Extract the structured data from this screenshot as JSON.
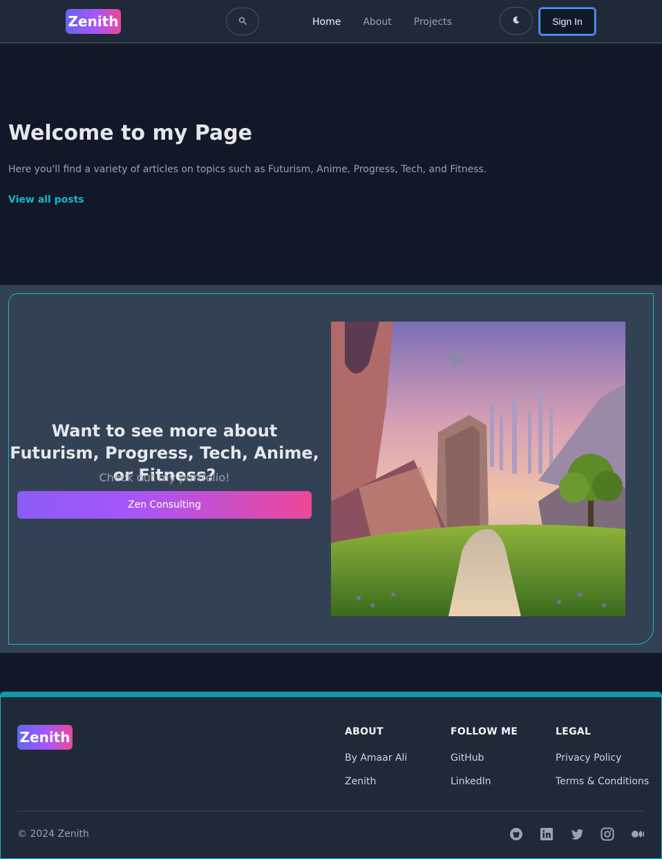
{
  "nav": {
    "logo": "Zenith",
    "links": [
      {
        "label": "Home",
        "active": true
      },
      {
        "label": "About",
        "active": false
      },
      {
        "label": "Projects",
        "active": false
      }
    ],
    "search_icon": "search-icon",
    "theme_icon": "moon-icon",
    "signin_label": "Sign In"
  },
  "hero": {
    "title": "Welcome to my Page",
    "subtitle": "Here you'll find a variety of articles on topics such as Futurism, Anime, Progress, Tech, and Fitness.",
    "link_label": "View all posts"
  },
  "promo": {
    "heading": "Want to see more about Futurism, Progress, Tech, Anime, or Fitness?",
    "subheading": "Check out my portfolio!",
    "button_label": "Zen Consulting",
    "image": "fantasy-landscape-image"
  },
  "footer": {
    "logo": "Zenith",
    "columns": [
      {
        "title": "ABOUT",
        "items": [
          "By Amaar Ali",
          "Zenith"
        ]
      },
      {
        "title": "FOLLOW ME",
        "items": [
          "GitHub",
          "LinkedIn"
        ]
      },
      {
        "title": "LEGAL",
        "items": [
          "Privacy Policy",
          "Terms & Conditions"
        ]
      }
    ],
    "copyright": "© 2024 Zenith",
    "socials": [
      "github-icon",
      "linkedin-icon",
      "twitter-icon",
      "instagram-icon",
      "medium-icon"
    ]
  },
  "colors": {
    "background": "#111827",
    "nav_bg": "#1f2937",
    "accent": "#14b8c8",
    "gradient_start": "#8b5cf6",
    "gradient_end": "#ec4899"
  }
}
